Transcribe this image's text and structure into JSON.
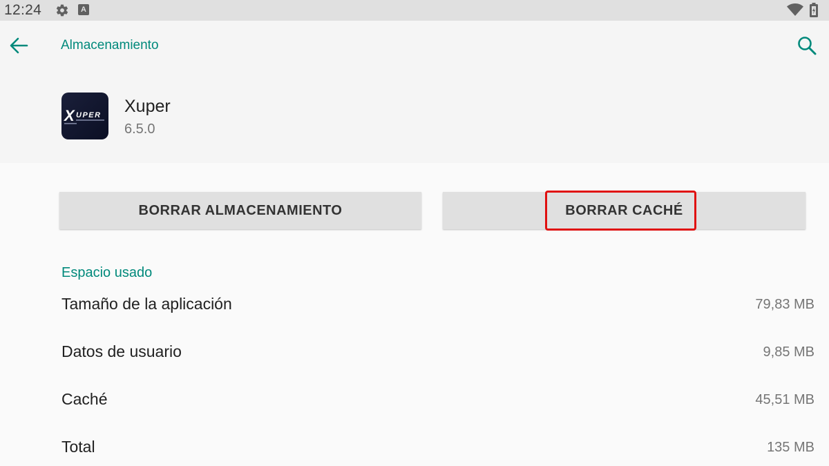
{
  "status_bar": {
    "time": "12:24",
    "icons": [
      "gear-icon",
      "a-notification-icon",
      "wifi-icon",
      "battery-icon"
    ]
  },
  "app_bar": {
    "title": "Almacenamiento",
    "back_icon": "arrow-left-icon",
    "search_icon": "search-icon"
  },
  "app": {
    "name": "Xuper",
    "version": "6.5.0",
    "icon_text": "UPER",
    "icon_letter": "X"
  },
  "buttons": {
    "clear_storage": "BORRAR ALMACENAMIENTO",
    "clear_cache": "BORRAR CACHÉ"
  },
  "section": {
    "title": "Espacio usado"
  },
  "rows": [
    {
      "label": "Tamaño de la aplicación",
      "value": "79,83 MB"
    },
    {
      "label": "Datos de usuario",
      "value": "9,85 MB"
    },
    {
      "label": "Caché",
      "value": "45,51 MB"
    },
    {
      "label": "Total",
      "value": "135 MB"
    }
  ],
  "colors": {
    "accent": "#00897b",
    "highlight": "#e01010",
    "button_bg": "#e0e0e0",
    "status_bar_bg": "#e0e0e0",
    "background": "#fafafa"
  }
}
